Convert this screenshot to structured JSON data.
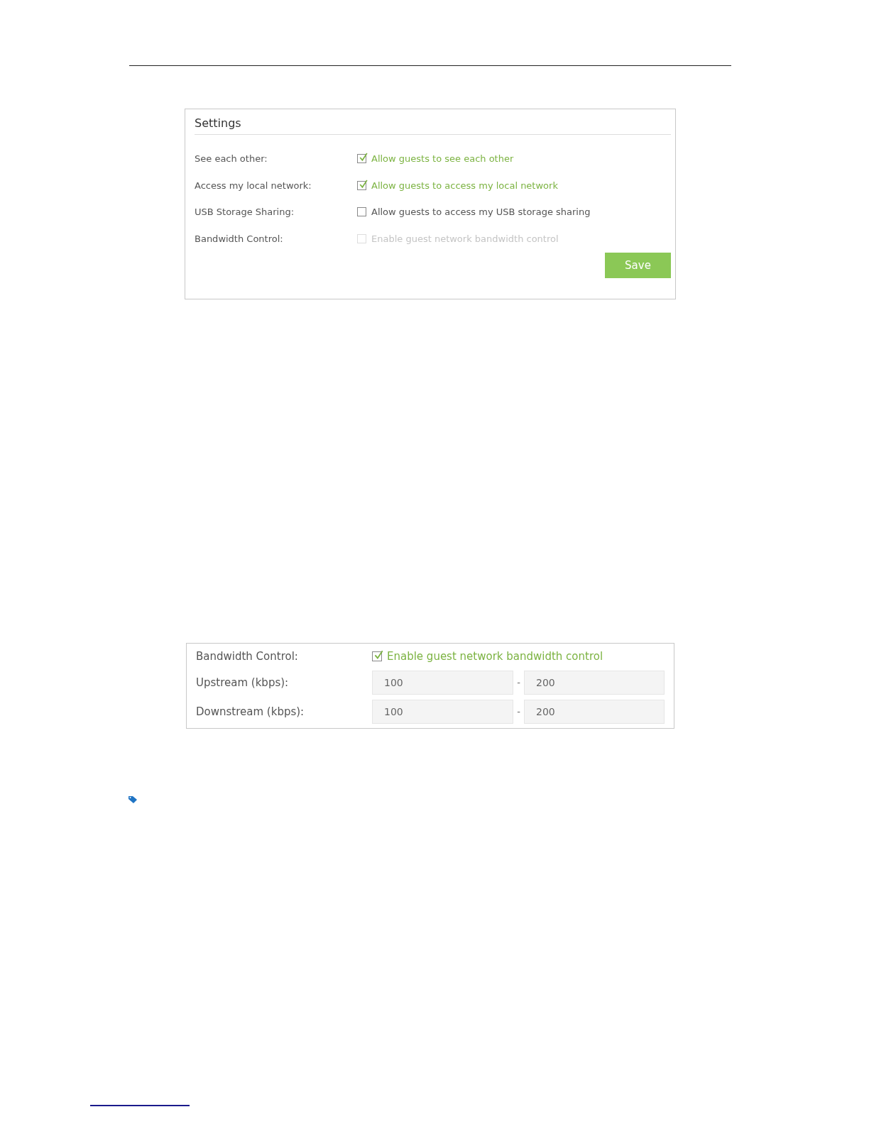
{
  "settings_panel": {
    "title": "Settings",
    "rows": [
      {
        "kind": "checkbox",
        "label": "See each other:",
        "option": "Allow guests to see each other",
        "checked": true,
        "disabled": false
      },
      {
        "kind": "checkbox",
        "label": "Access my local network:",
        "option": "Allow guests to access my local network",
        "checked": true,
        "disabled": false
      },
      {
        "kind": "checkbox",
        "label": "USB Storage Sharing:",
        "option": "Allow guests to access my USB storage sharing",
        "checked": false,
        "disabled": false
      },
      {
        "kind": "checkbox",
        "label": "Bandwidth Control:",
        "option": "Enable guest network bandwidth control",
        "checked": false,
        "disabled": true
      }
    ],
    "save_button": "Save"
  },
  "bandwidth_panel": {
    "rows": [
      {
        "kind": "checkbox",
        "label": "Bandwidth Control:",
        "option": "Enable guest network bandwidth control",
        "checked": true,
        "disabled": false
      },
      {
        "kind": "range",
        "label": "Upstream (kbps):",
        "from": "100",
        "separator": "-",
        "to": "200"
      },
      {
        "kind": "range",
        "label": "Downstream (kbps):",
        "from": "100",
        "separator": "-",
        "to": "200"
      }
    ]
  }
}
